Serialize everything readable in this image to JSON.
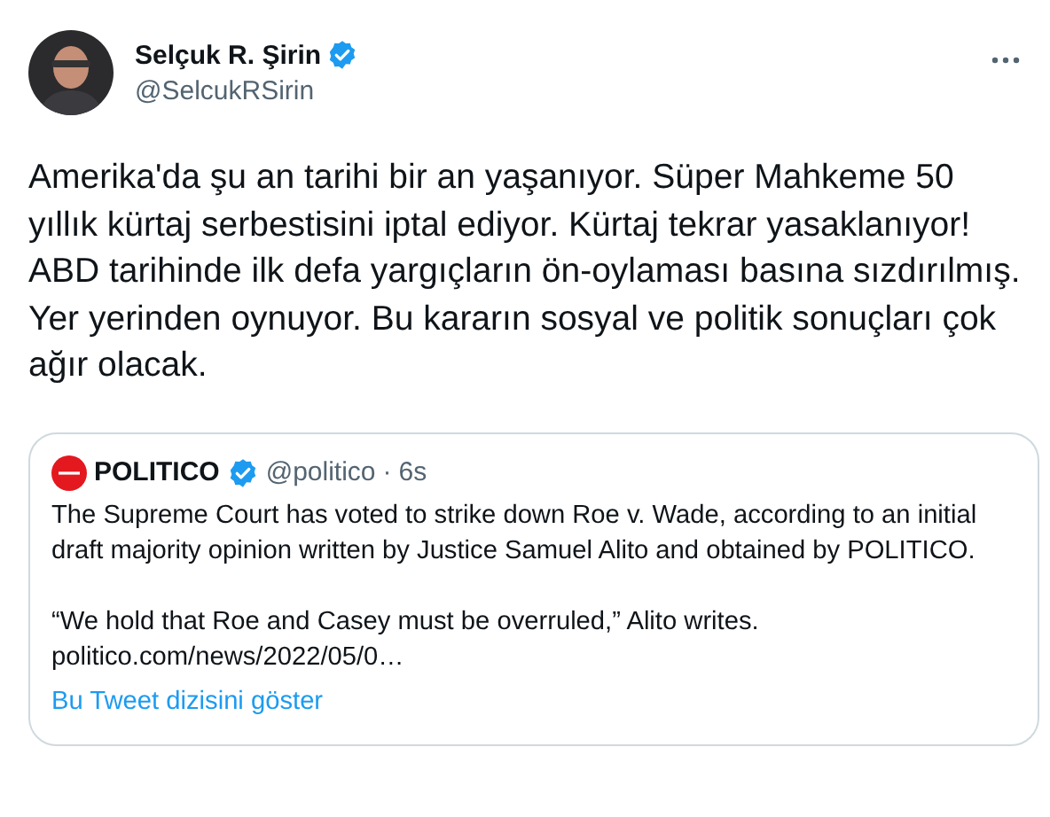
{
  "author": {
    "name": "Selçuk R. Şirin",
    "handle": "@SelcukRSirin",
    "verified": true
  },
  "text": "Amerika'da şu an tarihi bir an yaşanıyor. Süper Mahkeme 50 yıllık kürtaj serbestisini iptal ediyor. Kürtaj tekrar yasaklanıyor! ABD tarihinde ilk defa yargıçların ön-oylaması basına sızdırılmış. Yer yerinden oynuyor. Bu kararın sosyal ve politik sonuçları çok ağır olacak.",
  "quote": {
    "name": "POLITICO",
    "verified": true,
    "handle": "@politico",
    "separator": "·",
    "time": "6s",
    "paragraphs": [
      "The Supreme Court has voted to strike down Roe v. Wade, according to an initial draft majority opinion written by Justice Samuel Alito and obtained by POLITICO.",
      "“We hold that Roe and Casey must be overruled,” Alito writes."
    ],
    "link": "politico.com/news/2022/05/0…",
    "show_thread": "Bu Tweet dizisini göster"
  }
}
